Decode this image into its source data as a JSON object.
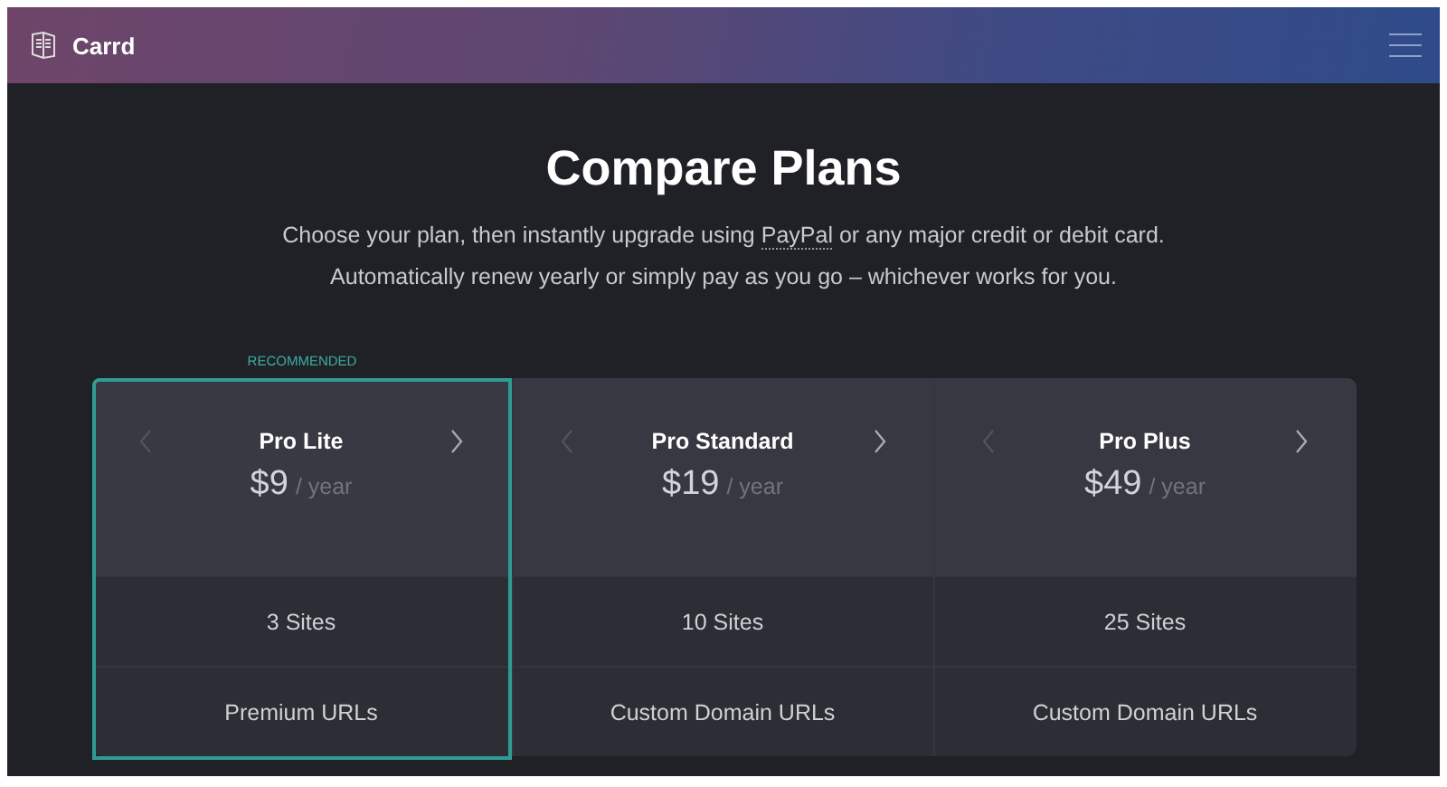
{
  "header": {
    "brand": "Carrd"
  },
  "title": "Compare Plans",
  "intro": [
    {
      "before": "Choose your plan, then instantly upgrade using ",
      "link": "PayPal",
      "after": " or any major credit or debit card."
    },
    {
      "before": "Automatically renew yearly or simply pay as you go – whichever works for you."
    }
  ],
  "recommended_label": "RECOMMENDED",
  "plans": [
    {
      "name": "Pro Lite",
      "price": "$9",
      "period": "/ year",
      "recommended": true,
      "prev_disabled": true,
      "next_disabled": false
    },
    {
      "name": "Pro Standard",
      "price": "$19",
      "period": "/ year",
      "recommended": false,
      "prev_disabled": true,
      "next_disabled": false
    },
    {
      "name": "Pro Plus",
      "price": "$49",
      "period": "/ year",
      "recommended": false,
      "prev_disabled": true,
      "next_disabled": false
    }
  ],
  "feature_rows": [
    [
      "3 Sites",
      "10 Sites",
      "25 Sites"
    ],
    [
      "Premium URLs",
      "Custom Domain URLs",
      "Custom Domain URLs"
    ]
  ]
}
